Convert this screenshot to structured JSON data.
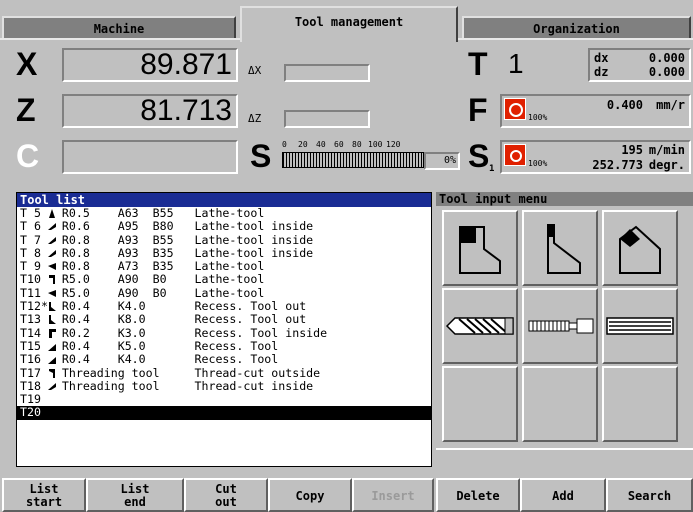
{
  "tabs": [
    {
      "label": "Machine"
    },
    {
      "label": "Tool management"
    },
    {
      "label": "Organization"
    }
  ],
  "axes": {
    "x": {
      "letter": "X",
      "value": "89.871",
      "delta_label": "ΔX"
    },
    "z": {
      "letter": "Z",
      "value": "81.713",
      "delta_label": "ΔZ"
    },
    "c": {
      "letter": "C",
      "value": ""
    }
  },
  "spindle": {
    "letter": "S",
    "scale_labels": [
      "0",
      "20",
      "40",
      "60",
      "80",
      "100",
      "120"
    ],
    "percent": "0%"
  },
  "tool": {
    "letter": "T",
    "number": "1",
    "dx_label": "dx",
    "dx_value": "0.000",
    "dz_label": "dz",
    "dz_value": "0.000"
  },
  "feed": {
    "letter": "F",
    "value": "0.400",
    "unit": "mm/r",
    "override": "100%"
  },
  "speed": {
    "letter": "S",
    "subscript": "1",
    "value": "195",
    "unit": "m/min",
    "override": "100%",
    "angle": "252.773",
    "angle_unit": "degr."
  },
  "tool_list": {
    "title": "Tool list",
    "rows": [
      {
        "text": "T 5   R0.5    A63  B55   Lathe-tool"
      },
      {
        "text": "T 6   R0.6    A95  B80   Lathe-tool inside"
      },
      {
        "text": "T 7   R0.8    A93  B55   Lathe-tool inside"
      },
      {
        "text": "T 8   R0.8    A93  B35   Lathe-tool inside"
      },
      {
        "text": "T 9   R0.8    A73  B35   Lathe-tool"
      },
      {
        "text": "T10   R5.0    A90  B0    Lathe-tool"
      },
      {
        "text": "T11   R5.0    A90  B0    Lathe-tool"
      },
      {
        "text": "T12*  R0.4    K4.0       Recess. Tool out"
      },
      {
        "text": "T13   R0.4    K8.0       Recess. Tool out"
      },
      {
        "text": "T14   R0.2    K3.0       Recess. Tool inside"
      },
      {
        "text": "T15   R0.4    K5.0       Recess. Tool"
      },
      {
        "text": "T16   R0.4    K4.0       Recess. Tool"
      },
      {
        "text": "T17   Threading tool     Thread-cut outside"
      },
      {
        "text": "T18   Threading tool     Thread-cut inside"
      },
      {
        "text": "T19"
      },
      {
        "text": "T20"
      }
    ]
  },
  "tool_menu": {
    "title": "Tool input menu"
  },
  "softkeys": [
    {
      "line1": "List",
      "line2": "start"
    },
    {
      "line1": "List",
      "line2": "end"
    },
    {
      "line1": "Cut",
      "line2": "out"
    },
    {
      "line1": "Copy",
      "line2": ""
    },
    {
      "line1": "Insert",
      "line2": ""
    },
    {
      "line1": "Delete",
      "line2": ""
    },
    {
      "line1": "Add",
      "line2": ""
    },
    {
      "line1": "Search",
      "line2": ""
    }
  ],
  "colors": {
    "list_header": "#1a2c94",
    "override_icon": "#e02000"
  }
}
